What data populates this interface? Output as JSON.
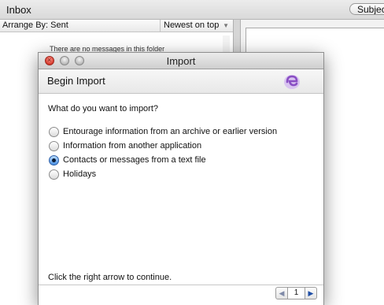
{
  "mail": {
    "title": "Inbox",
    "subject_button": "Subject",
    "arrange_label": "Arrange By: Sent",
    "sort_order": "Newest on top",
    "empty_message": "There are no messages in this folder"
  },
  "dialog": {
    "title": "Import",
    "section_title": "Begin Import",
    "question": "What do you want to import?",
    "options": [
      {
        "label": "Entourage information from an archive or earlier version",
        "selected": false
      },
      {
        "label": "Information from another application",
        "selected": false
      },
      {
        "label": "Contacts or messages from a text file",
        "selected": true
      },
      {
        "label": "Holidays",
        "selected": false
      }
    ],
    "footer_instruction": "Click the right arrow to continue.",
    "page_number": "1"
  },
  "colors": {
    "logo_purple": "#8a4fc4",
    "radio_selected": "#4a90e2"
  }
}
